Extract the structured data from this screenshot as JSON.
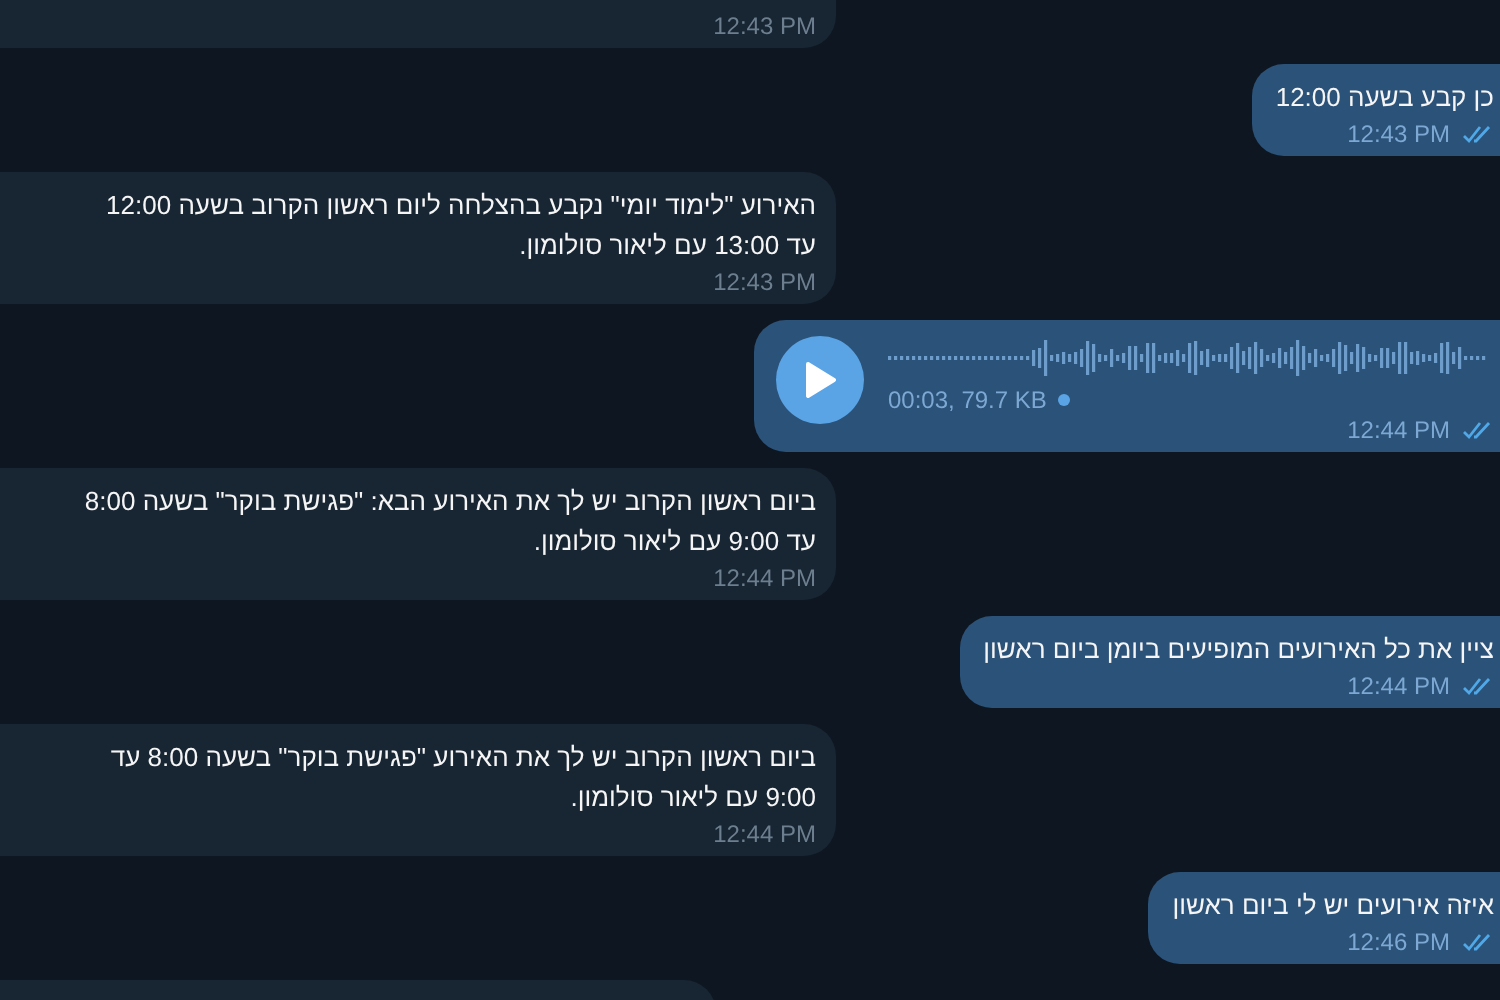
{
  "messages": [
    {
      "kind": "text",
      "outgoing": false,
      "time": "12:43 PM"
    },
    {
      "kind": "text",
      "outgoing": true,
      "text": "כן קבע בשעה 12:00",
      "time": "12:43 PM",
      "read": true
    },
    {
      "kind": "text",
      "outgoing": false,
      "text": "האירוע \"לימוד יומי\" נקבע בהצלחה ליום ראשון הקרוב בשעה 12:00 עד 13:00 עם ליאור סולומון.",
      "time": "12:43 PM"
    },
    {
      "kind": "voice",
      "outgoing": true,
      "meta": "00:03, 79.7 KB",
      "listened": false,
      "time": "12:44 PM",
      "read": true
    },
    {
      "kind": "text",
      "outgoing": false,
      "text": "ביום ראשון הקרוב יש לך את האירוע הבא: \"פגישת בוקר\" בשעה 8:00 עד 9:00 עם ליאור סולומון.",
      "time": "12:44 PM"
    },
    {
      "kind": "text",
      "outgoing": true,
      "text": "ציין את כל האירועים המופיעים ביומן ביום ראשון",
      "time": "12:44 PM",
      "read": true
    },
    {
      "kind": "text",
      "outgoing": false,
      "text": "ביום ראשון הקרוב יש לך את האירוע \"פגישת בוקר\" בשעה 8:00 עד 9:00 עם ליאור סולומון.",
      "time": "12:44 PM"
    },
    {
      "kind": "text",
      "outgoing": true,
      "text": "איזה אירועים יש לי ביום ראשון",
      "time": "12:46 PM",
      "read": true
    },
    {
      "kind": "text",
      "outgoing": false
    }
  ]
}
